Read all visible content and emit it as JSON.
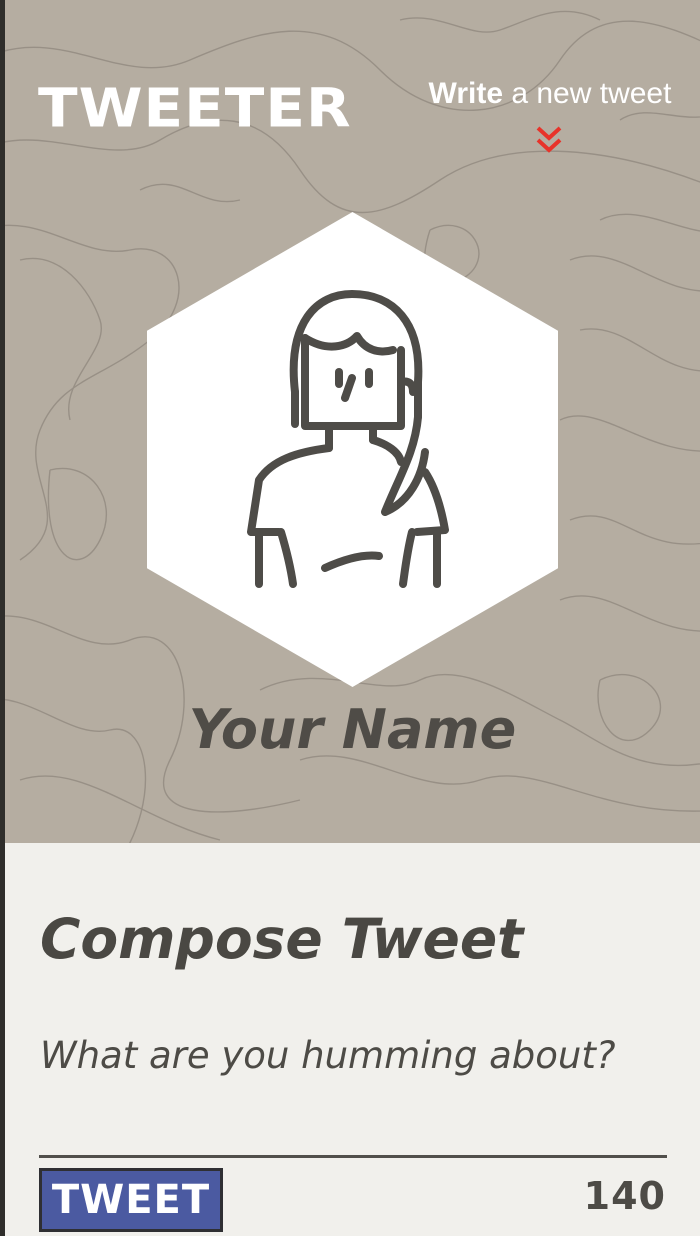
{
  "header": {
    "logo": "TWEETER",
    "write_link_bold": "Write",
    "write_link_rest": " a new tweet",
    "chevron_icon": "double-chevron-down-icon",
    "accent_color": "#e8332a"
  },
  "profile": {
    "avatar_icon": "woman-avatar-icon",
    "name": "Your Name"
  },
  "compose": {
    "title": "Compose Tweet",
    "placeholder": "What are you humming about?",
    "value": "",
    "tweet_button_label": "TWEET",
    "char_counter": "140",
    "button_color": "#4b5aa1"
  }
}
